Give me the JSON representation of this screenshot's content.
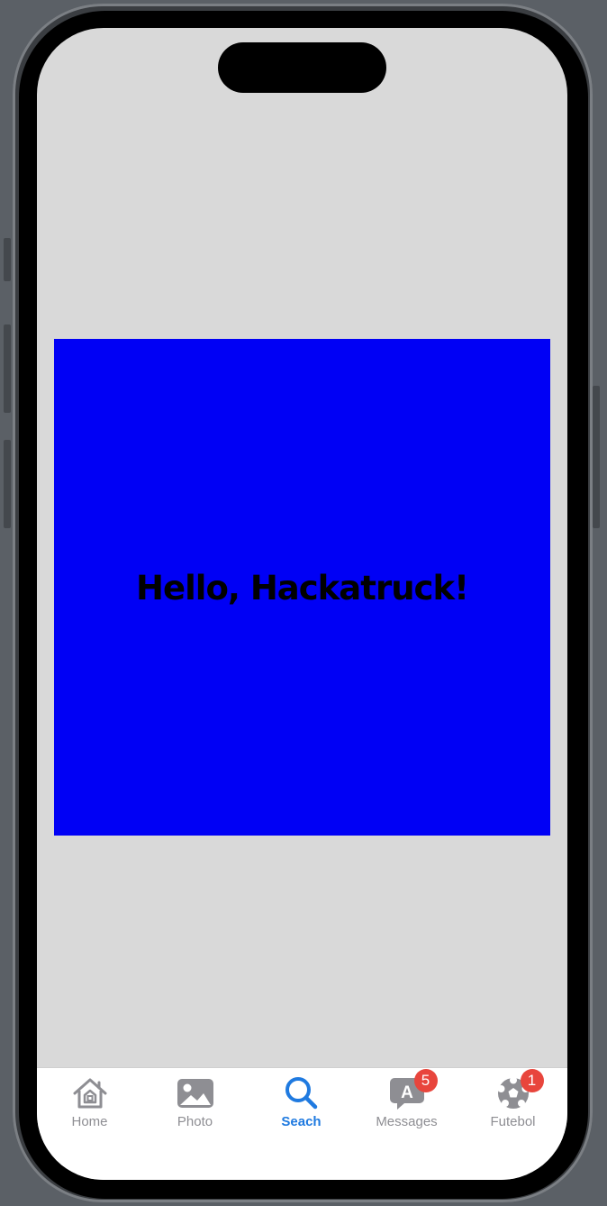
{
  "screen": {
    "background_color": "#d9d9d9",
    "box_color": "#0000f5",
    "greeting": "Hello, Hackatruck!"
  },
  "tabbar": {
    "active_color": "#1f7ae0",
    "inactive_color": "#8e8e93",
    "badge_color": "#e8453c",
    "tabs": [
      {
        "label": "Home",
        "icon": "house-icon",
        "active": false
      },
      {
        "label": "Photo",
        "icon": "photo-icon",
        "active": false
      },
      {
        "label": "Seach",
        "icon": "magnifying-glass-icon",
        "active": true
      },
      {
        "label": "Messages",
        "icon": "message-bubble-icon",
        "active": false,
        "badge": "5",
        "glyph": "A"
      },
      {
        "label": "Futebol",
        "icon": "soccer-ball-icon",
        "active": false,
        "badge": "1"
      }
    ]
  }
}
